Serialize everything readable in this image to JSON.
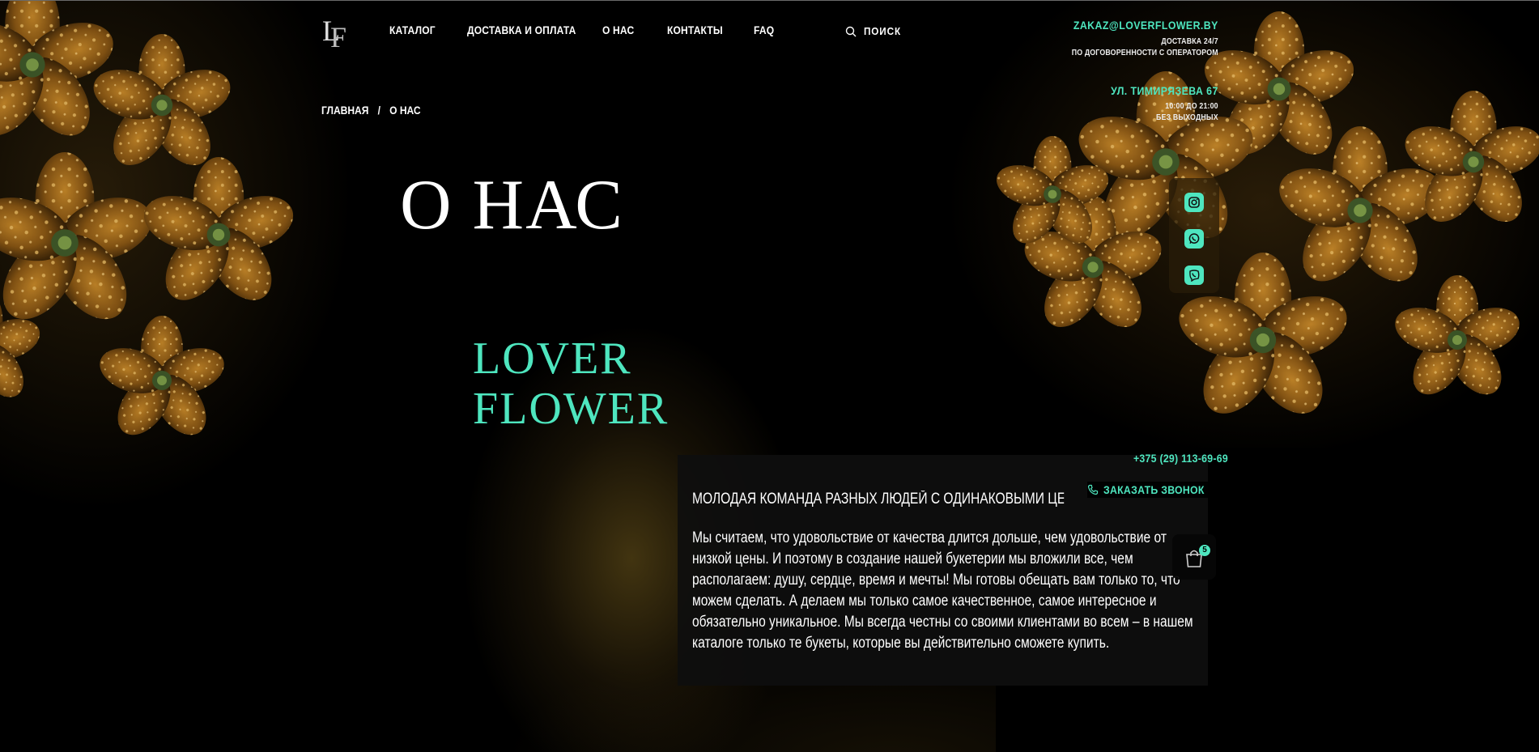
{
  "brand_logo": {
    "text": "LF"
  },
  "nav": {
    "items": [
      {
        "label": "КАТАЛОГ"
      },
      {
        "label": "ДОСТАВКА И ОПЛАТА"
      },
      {
        "label": "О НАС"
      },
      {
        "label": "КОНТАКТЫ"
      },
      {
        "label": "FAQ"
      }
    ],
    "search_label": "ПОИСК"
  },
  "contacts": {
    "email": "ZAKAZ@LOVERFLOWER.BY",
    "delivery_line1": "ДОСТАВКА 24/7",
    "delivery_line2": "ПО ДОГОВОРЕННОСТИ С ОПЕРАТОРОМ",
    "address": "УЛ. ТИМИРЯЗЕВА 67",
    "hours": "10:00 ДО 21:00",
    "days": "БЕЗ ВЫХОДНЫХ",
    "phone": "+375 (29) 113-69-69",
    "callback_label": "ЗАКАЗАТЬ ЗВОНОК"
  },
  "breadcrumb": {
    "home": "ГЛАВНАЯ",
    "separator": "/",
    "current": "О НАС"
  },
  "page_title": "О НАС",
  "brand_name": {
    "line1": "LOVER",
    "line2": "FLOWER"
  },
  "about": {
    "heading": "МОЛОДАЯ КОМАНДА РАЗНЫХ ЛЮДЕЙ С ОДИНАКОВЫМИ ЦЕННОСТЯМИ",
    "text": "Мы считаем, что удовольствие от качества длится дольше, чем удовольствие от низкой цены. И поэтому в создание нашей букетерии мы вложили все, чем располагаем: душу, сердце, время и мечты! Мы готовы обещать вам только то, что можем сделать. А делаем мы только самое качественное, самое интересное и обязательно уникальное. Мы всегда честны со своими клиентами во всем – в нашем каталоге только те букеты, которые вы действительно сможете купить."
  },
  "social": {
    "icons": [
      "instagram-icon",
      "whatsapp-icon",
      "viber-icon"
    ]
  },
  "cart": {
    "count": "5"
  },
  "colors": {
    "accent": "#4ee6bf",
    "background": "#000000"
  }
}
